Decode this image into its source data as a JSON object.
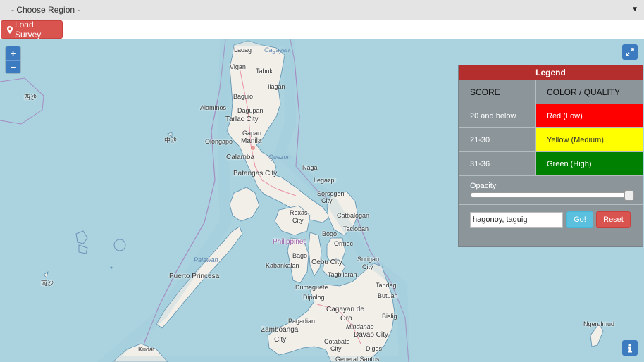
{
  "region_select": {
    "value": "- Choose Region -",
    "arrow": "▼"
  },
  "load_survey": {
    "label": "Load Survey",
    "icon": "map-marker-icon"
  },
  "map": {
    "zoom_in": "+",
    "zoom_out": "−",
    "labels": [
      {
        "text": "Laoag",
        "cls": ""
      },
      {
        "text": "Cagayan",
        "cls": "water"
      },
      {
        "text": "Vigan",
        "cls": ""
      },
      {
        "text": "Tabuk",
        "cls": ""
      },
      {
        "text": "Ilagan",
        "cls": ""
      },
      {
        "text": "Baguio",
        "cls": ""
      },
      {
        "text": "Alaminos",
        "cls": ""
      },
      {
        "text": "Dagupan",
        "cls": ""
      },
      {
        "text": "Tarlac City",
        "cls": "big"
      },
      {
        "text": "Gapan",
        "cls": ""
      },
      {
        "text": "Olongapo",
        "cls": ""
      },
      {
        "text": "Manila",
        "cls": "big"
      },
      {
        "text": "Quezon",
        "cls": "water"
      },
      {
        "text": "Calamba",
        "cls": "big"
      },
      {
        "text": "Batangas City",
        "cls": "big"
      },
      {
        "text": "Naga",
        "cls": ""
      },
      {
        "text": "Legazpi",
        "cls": ""
      },
      {
        "text": "Sorsogon",
        "cls": ""
      },
      {
        "text": "City",
        "cls": ""
      },
      {
        "text": "Roxas",
        "cls": ""
      },
      {
        "text": "City",
        "cls": ""
      },
      {
        "text": "Catbalogan",
        "cls": ""
      },
      {
        "text": "Tacloban",
        "cls": ""
      },
      {
        "text": "Bogo",
        "cls": ""
      },
      {
        "text": "Philippines",
        "cls": "country"
      },
      {
        "text": "Ormoc",
        "cls": ""
      },
      {
        "text": "Bago",
        "cls": ""
      },
      {
        "text": "Surigao",
        "cls": ""
      },
      {
        "text": "City",
        "cls": ""
      },
      {
        "text": "Kabankalan",
        "cls": ""
      },
      {
        "text": "Cebu City",
        "cls": "big"
      },
      {
        "text": "Tagbilaran",
        "cls": ""
      },
      {
        "text": "Palawan",
        "cls": "water"
      },
      {
        "text": "Puerto Princesa",
        "cls": "big"
      },
      {
        "text": "Dumaguete",
        "cls": ""
      },
      {
        "text": "Tandag",
        "cls": ""
      },
      {
        "text": "Dipolog",
        "cls": ""
      },
      {
        "text": "Butuan",
        "cls": ""
      },
      {
        "text": "Cagayan de",
        "cls": "big"
      },
      {
        "text": "Oro",
        "cls": "big"
      },
      {
        "text": "Bislig",
        "cls": ""
      },
      {
        "text": "Pagadian",
        "cls": ""
      },
      {
        "text": "Mindanao",
        "cls": "ital"
      },
      {
        "text": "Zamboanga",
        "cls": "big"
      },
      {
        "text": "City",
        "cls": "big"
      },
      {
        "text": "Davao City",
        "cls": "big"
      },
      {
        "text": "Cotabato",
        "cls": ""
      },
      {
        "text": "City",
        "cls": ""
      },
      {
        "text": "Digos",
        "cls": ""
      },
      {
        "text": "General Santos",
        "cls": ""
      },
      {
        "text": "Kudat",
        "cls": ""
      },
      {
        "text": "Ngerulmud",
        "cls": ""
      },
      {
        "text": "西沙",
        "cls": ""
      },
      {
        "text": "中沙",
        "cls": ""
      },
      {
        "text": "南沙",
        "cls": ""
      }
    ]
  },
  "legend": {
    "title": "Legend",
    "col_score": "SCORE",
    "col_color": "COLOR / QUALITY",
    "rows": [
      {
        "score": "20 and below",
        "quality": "Red (Low)",
        "color": "#ff0000",
        "text_color": "#ffffff"
      },
      {
        "score": "21-30",
        "quality": "Yellow (Medium)",
        "color": "#ffff00",
        "text_color": "#333333"
      },
      {
        "score": "31-36",
        "quality": "Green (High)",
        "color": "#008000",
        "text_color": "#ffffff"
      }
    ],
    "opacity_label": "Opacity",
    "opacity_value": 1.0,
    "search_value": "hagonoy, taguig",
    "go_label": "Go!",
    "reset_label": "Reset"
  }
}
